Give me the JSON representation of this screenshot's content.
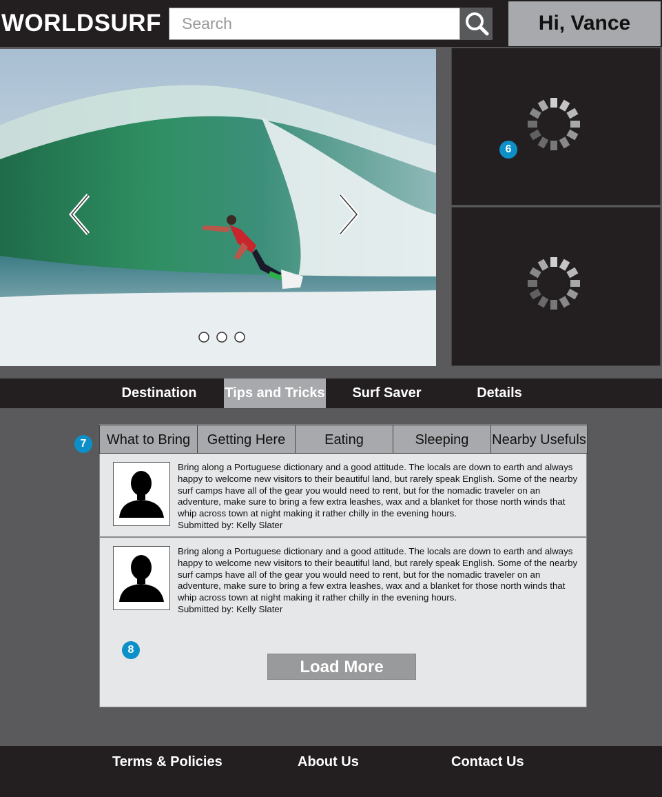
{
  "header": {
    "logo": "WORLDSURF",
    "search_placeholder": "Search",
    "search_icon": "search-icon",
    "greeting": "Hi, Vance"
  },
  "hero": {
    "prev_icon": "chevron-left-icon",
    "next_icon": "chevron-right-icon",
    "slide_dots": 3
  },
  "annotations": {
    "m6": "6",
    "m7": "7",
    "m8": "8"
  },
  "tabs": [
    {
      "label": "Destination"
    },
    {
      "label": "Tips and Tricks"
    },
    {
      "label": "Surf Saver"
    },
    {
      "label": "Details"
    }
  ],
  "subtabs": [
    {
      "label": "What to Bring"
    },
    {
      "label": "Getting Here"
    },
    {
      "label": "Eating"
    },
    {
      "label": "Sleeping"
    },
    {
      "label": "Nearby Usefuls"
    }
  ],
  "comments": [
    {
      "text": "Bring along a Portuguese dictionary and a good attitude. The locals are down to earth and always happy to welcome new visitors to their beautiful land, but rarely speak English. Some of the nearby surf camps have all of the gear you would need to rent, but for the nomadic traveler on an adventure, make sure to bring a few extra leashes, wax and a blanket for those north winds that whip across town at night making it rather chilly in the evening hours.",
      "submitted": "Submitted by: Kelly Slater"
    },
    {
      "text": "Bring along a Portuguese dictionary and a good attitude. The locals are down to earth and always happy to welcome new visitors to their beautiful land, but rarely speak English. Some of the nearby surf camps have all of the gear you would need to rent, but for the nomadic traveler on an adventure, make sure to bring a few extra leashes, wax and a blanket for those north winds that whip across town at night making it rather chilly in the evening hours.",
      "submitted": "Submitted by: Kelly Slater"
    }
  ],
  "load_more": "Load More",
  "footer": {
    "links": [
      {
        "label": "Terms & Policies"
      },
      {
        "label": "About Us"
      },
      {
        "label": "Contact Us"
      }
    ]
  },
  "colors": {
    "dark": "#231f20",
    "gray": "#a7a9ac",
    "marker": "#0d8fc8"
  }
}
